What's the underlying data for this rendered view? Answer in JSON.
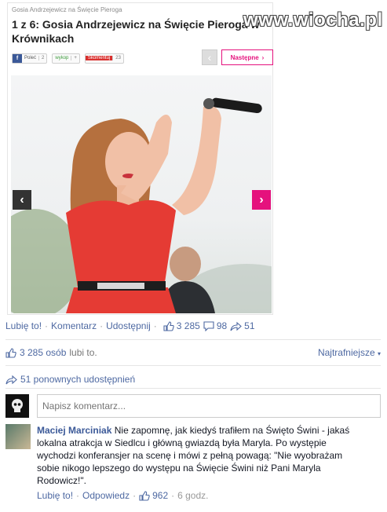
{
  "article": {
    "breadcrumb": "Gosia Andrzejewicz na Święcie Pieroga",
    "title": "1 z 6:  Gosia Andrzejewicz na Święcie Pieroga w Krównikach",
    "share": {
      "fb_label": "Poleć",
      "fb_count": "2",
      "wykop_label": "wykop",
      "wykop_count": "+",
      "red_label": "Skomentuj",
      "red_count": "23"
    },
    "prev_icon": "chevron-left-icon",
    "next_label": "Następne",
    "photo_description_icon": "photo",
    "colors": {
      "accent": "#e5127d",
      "fb": "#3b5998"
    }
  },
  "watermark": "www.wiocha.pl",
  "actions": {
    "like": "Lubię to!",
    "comment": "Komentarz",
    "share": "Udostępnij",
    "likes_count": "3 285",
    "comments_count": "98",
    "shares_count": "51"
  },
  "likes_summary": {
    "count_text": "3 285 osób",
    "suffix": "lubi to.",
    "ordering": "Najtrafniejsze"
  },
  "shares_summary": "51 ponownych udostępnień",
  "composer": {
    "placeholder": "Napisz komentarz..."
  },
  "comment": {
    "author": "Maciej Marciniak",
    "text": "Nie zapomnę, jak kiedyś trafiłem na Święto Świni - jakaś lokalna atrakcja w Siedlcu i główną gwiazdą była Maryla. Po występie wychodzi konferansjer na scenę i mówi z pełną powagą: \"Nie wyobrażam sobie nikogo lepszego do występu na Święcie Świni niż Pani Maryla Rodowicz!\".",
    "like": "Lubię to!",
    "reply": "Odpowiedz",
    "likes": "962",
    "time": "6 godz."
  }
}
